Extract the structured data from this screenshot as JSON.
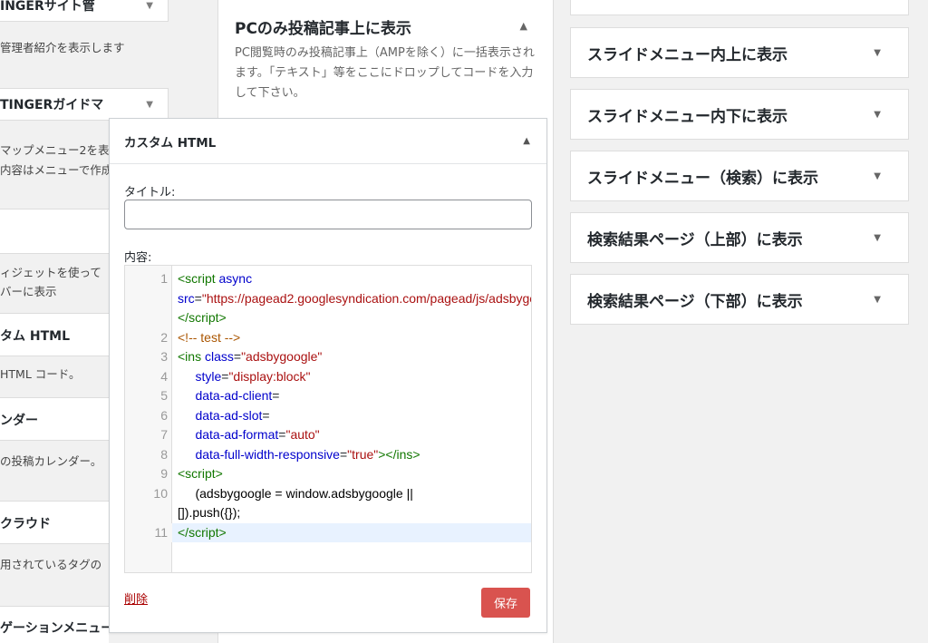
{
  "left": {
    "w1_title": "INGERサイト管",
    "w1_desc": "管理者紹介を表示します",
    "w2_title": "TINGERガイドマ",
    "w2_desc1": "マップメニュー2を表",
    "w2_desc2": "内容はメニューで作成",
    "w3_desc1": "ィジェットを使って",
    "w3_desc2": "バーに表示",
    "w4_title": "タム HTML",
    "w4_desc": " HTML コード。",
    "w5_title": "ンダー",
    "w5_desc": "の投稿カレンダー。",
    "w6_title": "クラウド",
    "w6_desc": "用されているタグの",
    "w7_title": "ゲーションメニュー"
  },
  "middle": {
    "title": "PCのみ投稿記事上に表示",
    "description": "PC閲覧時のみ投稿記事上（AMPを除く）に一括表示されます。「テキスト」等をここにドロップしてコードを入力して下さい。"
  },
  "widget": {
    "header": "カスタム HTML",
    "title_label": "タイトル:",
    "title_value": "",
    "content_label": "内容:",
    "delete_label": "削除",
    "save_label": "保存",
    "code_line_numbers": [
      "1",
      "2",
      "3",
      "4",
      "5",
      "6",
      "7",
      "8",
      "9",
      "10",
      "11"
    ]
  },
  "right": {
    "items": [
      {
        "label": "スライドメニュー内上に表示"
      },
      {
        "label": "スライドメニュー内下に表示"
      },
      {
        "label": "スライドメニュー（検索）に表示"
      },
      {
        "label": "検索結果ページ（上部）に表示"
      },
      {
        "label": "検索結果ページ（下部）に表示"
      }
    ]
  },
  "icons": {
    "collapse": "triangle-down-icon",
    "expand": "triangle-up-icon"
  }
}
